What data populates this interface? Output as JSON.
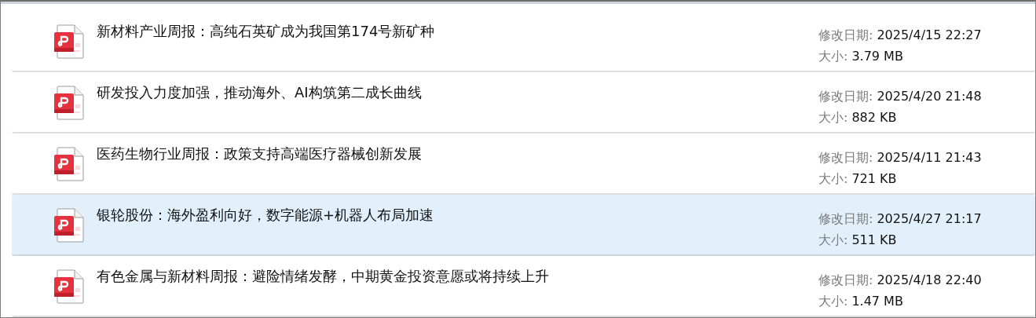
{
  "files": [
    {
      "title": "新材料产业周报：高纯石英矿成为我国第174号新矿种",
      "date_label": "修改日期:",
      "date": "2025/4/15 22:27",
      "size_label": "大小:",
      "size": "3.79 MB",
      "selected": false
    },
    {
      "title": "研发投入力度加强，推动海外、AI构筑第二成长曲线",
      "date_label": "修改日期:",
      "date": "2025/4/20 21:48",
      "size_label": "大小:",
      "size": "882 KB",
      "selected": false
    },
    {
      "title": "医药生物行业周报：政策支持高端医疗器械创新发展",
      "date_label": "修改日期:",
      "date": "2025/4/11 21:43",
      "size_label": "大小:",
      "size": "721 KB",
      "selected": false
    },
    {
      "title": "银轮股份：海外盈利向好，数字能源+机器人布局加速",
      "date_label": "修改日期:",
      "date": "2025/4/27 21:17",
      "size_label": "大小:",
      "size": "511 KB",
      "selected": true
    },
    {
      "title": "有色金属与新材料周报：避险情绪发酵，中期黄金投资意愿或将持续上升",
      "date_label": "修改日期:",
      "date": "2025/4/18 22:40",
      "size_label": "大小:",
      "size": "1.47 MB",
      "selected": false
    }
  ]
}
